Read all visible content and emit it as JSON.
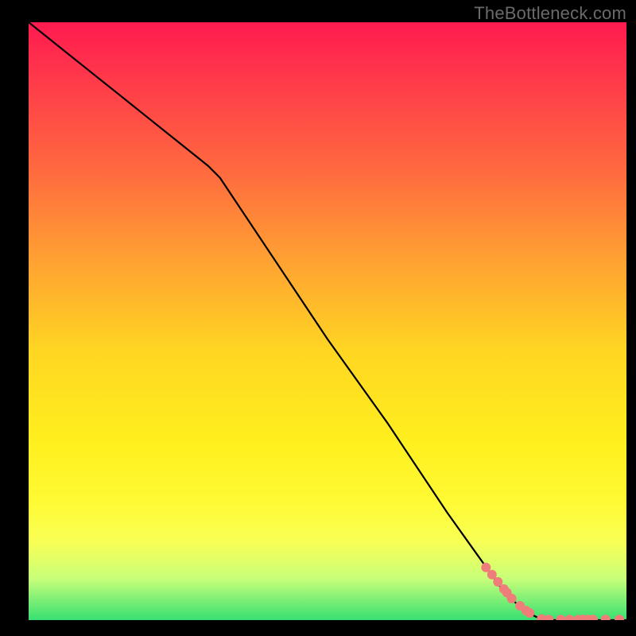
{
  "watermark": "TheBottleneck.com",
  "colors": {
    "gradient_top": "#ff1a4f",
    "gradient_mid": "#ffef1e",
    "gradient_bottom": "#37e072",
    "curve": "#000000",
    "marker": "#ef7e7b",
    "frame": "#000000"
  },
  "chart_data": {
    "type": "line",
    "note": "Values are normalized plot coordinates (0–100) inferred from pixel positions since the chart has no numeric axis labels.",
    "xlabel": "",
    "ylabel": "",
    "legend": null,
    "xlim": [
      0,
      100
    ],
    "ylim": [
      0,
      100
    ],
    "series": [
      {
        "name": "curve",
        "x": [
          0,
          5,
          10,
          15,
          20,
          25,
          30,
          32,
          40,
          50,
          60,
          70,
          75,
          80,
          84,
          86,
          90,
          95,
          100
        ],
        "y": [
          100,
          96,
          92,
          88,
          84,
          80,
          76,
          74,
          62,
          47,
          33,
          18,
          11,
          4,
          1,
          0,
          0,
          0,
          0
        ],
        "kind": "line"
      },
      {
        "name": "markers",
        "x": [
          76.5,
          77.5,
          78.5,
          79.5,
          80.0,
          80.8,
          82.2,
          83.2,
          83.8,
          85.8,
          87.0,
          89.0,
          90.5,
          92.0,
          92.8,
          93.6,
          94.4,
          96.5,
          98.8
        ],
        "y": [
          8.8,
          7.6,
          6.4,
          5.2,
          4.6,
          3.6,
          2.4,
          1.6,
          1.2,
          0.2,
          0.1,
          0.1,
          0.1,
          0.1,
          0.1,
          0.1,
          0.1,
          0.1,
          0.1
        ],
        "kind": "scatter",
        "markersize": 6
      }
    ]
  }
}
